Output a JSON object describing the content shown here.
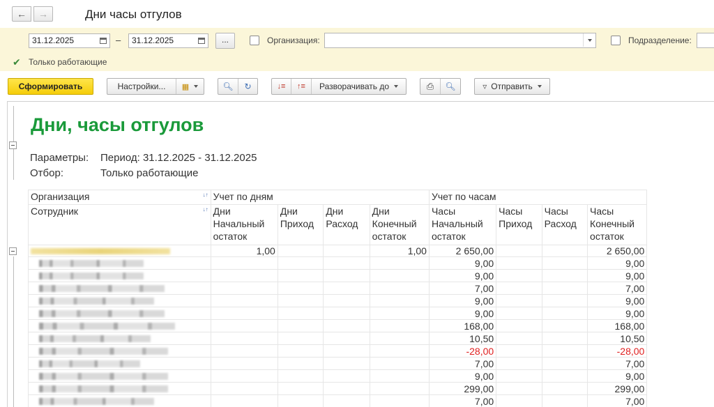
{
  "window": {
    "title": "Дни часы отгулов"
  },
  "filters": {
    "date_from": "31.12.2025",
    "date_to": "31.12.2025",
    "dash": "–",
    "period_button": "...",
    "organization_label": "Организация:",
    "organization_value": "",
    "subdivision_label": "Подразделение:",
    "subdivision_value": "",
    "only_working_label": "Только работающие"
  },
  "toolbar": {
    "generate": "Сформировать",
    "settings": "Настройки...",
    "expand_to": "Разворачивать до",
    "send": "Отправить"
  },
  "report": {
    "title": "Дни, часы отгулов",
    "params_label": "Параметры:",
    "params_value": "Период: 31.12.2025 - 31.12.2025",
    "filter_label": "Отбор:",
    "filter_value": "Только работающие",
    "header": {
      "organization": "Организация",
      "employee": "Сотрудник",
      "days_group": "Учет по дням",
      "hours_group": "Учет по часам",
      "cols": [
        "Дни Начальный остаток",
        "Дни Приход",
        "Дни Расход",
        "Дни Конечный остаток",
        "Часы Начальный остаток",
        "Часы Приход",
        "Часы Расход",
        "Часы Конечный остаток"
      ]
    },
    "total_row": {
      "d_start": "1,00",
      "d_in": "",
      "d_out": "",
      "d_end": "1,00",
      "h_start": "2 650,00",
      "h_in": "",
      "h_out": "",
      "h_end": "2 650,00"
    },
    "rows": [
      {
        "h_start": "9,00",
        "h_end": "9,00",
        "neg": false
      },
      {
        "h_start": "9,00",
        "h_end": "9,00",
        "neg": false
      },
      {
        "h_start": "7,00",
        "h_end": "7,00",
        "neg": false
      },
      {
        "h_start": "9,00",
        "h_end": "9,00",
        "neg": false
      },
      {
        "h_start": "9,00",
        "h_end": "9,00",
        "neg": false
      },
      {
        "h_start": "168,00",
        "h_end": "168,00",
        "neg": false
      },
      {
        "h_start": "10,50",
        "h_end": "10,50",
        "neg": false
      },
      {
        "h_start": "-28,00",
        "h_end": "-28,00",
        "neg": true
      },
      {
        "h_start": "7,00",
        "h_end": "7,00",
        "neg": false
      },
      {
        "h_start": "9,00",
        "h_end": "9,00",
        "neg": false
      },
      {
        "h_start": "299,00",
        "h_end": "299,00",
        "neg": false
      },
      {
        "h_start": "7,00",
        "h_end": "7,00",
        "neg": false
      },
      {
        "h_start": "7,00",
        "h_end": "7,00",
        "neg": false
      }
    ]
  }
}
